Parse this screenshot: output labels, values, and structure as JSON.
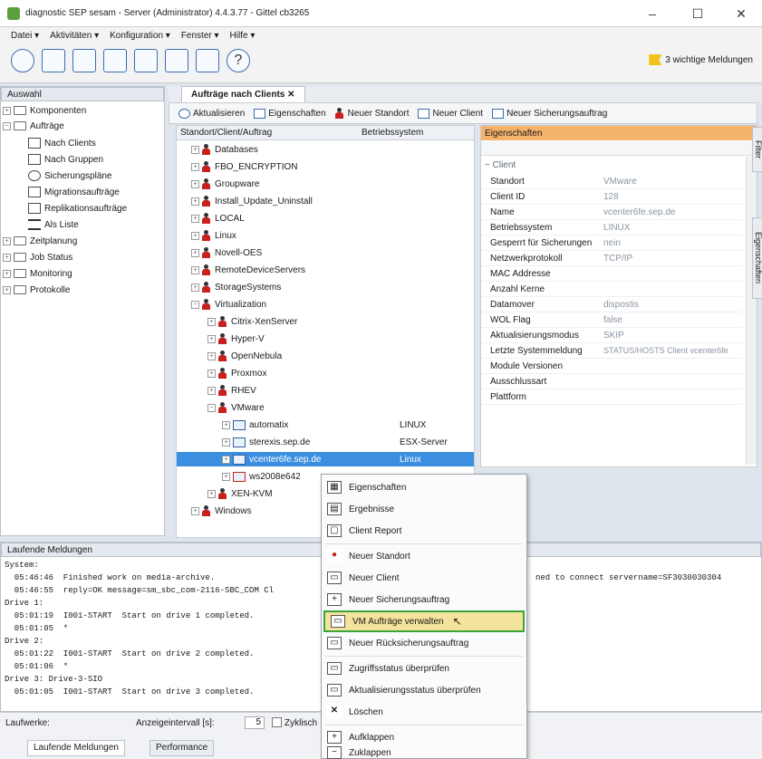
{
  "window": {
    "title": "diagnostic SEP sesam - Server (Administrator) 4.4.3.77 - Gittel cb3265",
    "minimize": "–",
    "maximize": "☐",
    "close": "✕"
  },
  "menubar": [
    "Datei ▾",
    "Aktivitäten ▾",
    "Konfiguration ▾",
    "Fenster ▾",
    "Hilfe ▾"
  ],
  "toolbar": {
    "warning_text": "3 wichtige Meldungen"
  },
  "left_panel": {
    "header": "Auswahl",
    "items": [
      {
        "label": "Komponenten"
      },
      {
        "label": "Aufträge"
      },
      {
        "label": "Nach Clients"
      },
      {
        "label": "Nach Gruppen"
      },
      {
        "label": "Sicherungspläne"
      },
      {
        "label": "Migrationsaufträge"
      },
      {
        "label": "Replikationsaufträge"
      },
      {
        "label": "Als Liste"
      },
      {
        "label": "Zeitplanung"
      },
      {
        "label": "Job Status"
      },
      {
        "label": "Monitoring"
      },
      {
        "label": "Protokolle"
      }
    ]
  },
  "tabs": {
    "active": "Aufträge nach Clients  ✕"
  },
  "subtoolbar": [
    "Aktualisieren",
    "Eigenschaften",
    "Neuer Standort",
    "Neuer Client",
    "Neuer Sicherungsauftrag"
  ],
  "tree": {
    "col1": "Standort/Client/Auftrag",
    "col2": "Betriebssystem",
    "rows": [
      {
        "label": "Databases",
        "os": ""
      },
      {
        "label": "FBO_ENCRYPTION",
        "os": ""
      },
      {
        "label": "Groupware",
        "os": ""
      },
      {
        "label": "Install_Update_Uninstall",
        "os": ""
      },
      {
        "label": "LOCAL",
        "os": ""
      },
      {
        "label": "Linux",
        "os": ""
      },
      {
        "label": "Novell-OES",
        "os": ""
      },
      {
        "label": "RemoteDeviceServers",
        "os": ""
      },
      {
        "label": "StorageSystems",
        "os": ""
      },
      {
        "label": "Virtualization",
        "os": ""
      },
      {
        "label": "Citrix-XenServer",
        "os": ""
      },
      {
        "label": "Hyper-V",
        "os": ""
      },
      {
        "label": "OpenNebula",
        "os": ""
      },
      {
        "label": "Proxmox",
        "os": ""
      },
      {
        "label": "RHEV",
        "os": ""
      },
      {
        "label": "VMware",
        "os": ""
      },
      {
        "label": "automatix",
        "os": "LINUX"
      },
      {
        "label": "sterexis.sep.de",
        "os": "ESX-Server"
      },
      {
        "label": "vcenter6fe.sep.de",
        "os": "Linux"
      },
      {
        "label": "ws2008e642",
        "os": ""
      },
      {
        "label": "XEN-KVM",
        "os": ""
      },
      {
        "label": "Windows",
        "os": ""
      }
    ]
  },
  "properties": {
    "header": "Eigenschaften",
    "section": "Client",
    "rows": [
      {
        "key": "Standort",
        "value": "VMware"
      },
      {
        "key": "Client ID",
        "value": "128"
      },
      {
        "key": "Name",
        "value": "vcenter6fe.sep.de"
      },
      {
        "key": "Betriebssystem",
        "value": "LINUX"
      },
      {
        "key": "Gesperrt für Sicherungen",
        "value": "nein"
      },
      {
        "key": "Netzwerkprotokoll",
        "value": "TCP/IP"
      },
      {
        "key": "MAC Addresse",
        "value": ""
      },
      {
        "key": "Anzahl Kerne",
        "value": ""
      },
      {
        "key": "Datamover",
        "value": "dispostis"
      },
      {
        "key": "WOL Flag",
        "value": "false"
      },
      {
        "key": "Aktualisierungsmodus",
        "value": "SKIP"
      },
      {
        "key": "Letzte Systemmeldung",
        "value": "STATUS/HOSTS Client vcenter6fe"
      },
      {
        "key": "Module Versionen",
        "value": ""
      },
      {
        "key": "Ausschlussart",
        "value": ""
      },
      {
        "key": "Plattform",
        "value": ""
      }
    ],
    "side_filter": "Filter",
    "side_eigen": "Eigenschaften"
  },
  "log": {
    "header": "Laufende Meldungen",
    "lines": [
      "System:",
      "  05:46:46  Finished work on media-archive.",
      "  05:46:55  reply=OK message=sm_sbc_com-2116-SBC_COM Cl",
      "Drive 1:",
      "  05:01:19  I001-START  Start on drive 1 completed.",
      "  05:01:05  *",
      "Drive 2:",
      "  05:01:22  I001-START  Start on drive 2 completed.",
      "  05:01:06  *",
      "Drive 3: Drive-3-SIO",
      "  05:01:05  I001-START  Start on drive 3 completed."
    ],
    "right_fragment": "ned to connect servername=SF3030030304"
  },
  "bottom": {
    "laufwerke": "Laufwerke:",
    "anzeige": "Anzeigeintervall [s]:",
    "interval": "5",
    "zyklus": "Zyklisch",
    "tab1": "Laufende Meldungen",
    "tab2": "Performance"
  },
  "context_menu": [
    {
      "label": "Eigenschaften",
      "icon": "▦"
    },
    {
      "label": "Ergebnisse",
      "icon": "▤"
    },
    {
      "label": "Client Report",
      "icon": "▢"
    },
    {
      "label": "Neuer Standort",
      "icon": "●"
    },
    {
      "label": "Neuer Client",
      "icon": "▭"
    },
    {
      "label": "Neuer Sicherungsauftrag",
      "icon": "+"
    },
    {
      "label": "VM Aufträge verwalten",
      "icon": "▭"
    },
    {
      "label": "Neuer Rücksicherungsauftrag",
      "icon": "▭"
    },
    {
      "label": "Zugriffsstatus überprüfen",
      "icon": "▭"
    },
    {
      "label": "Aktualisierungsstatus überprüfen",
      "icon": "▭"
    },
    {
      "label": "Löschen",
      "icon": "✕"
    },
    {
      "label": "Aufklappen",
      "icon": "+"
    },
    {
      "label": "Zuklappen",
      "icon": "−"
    }
  ]
}
